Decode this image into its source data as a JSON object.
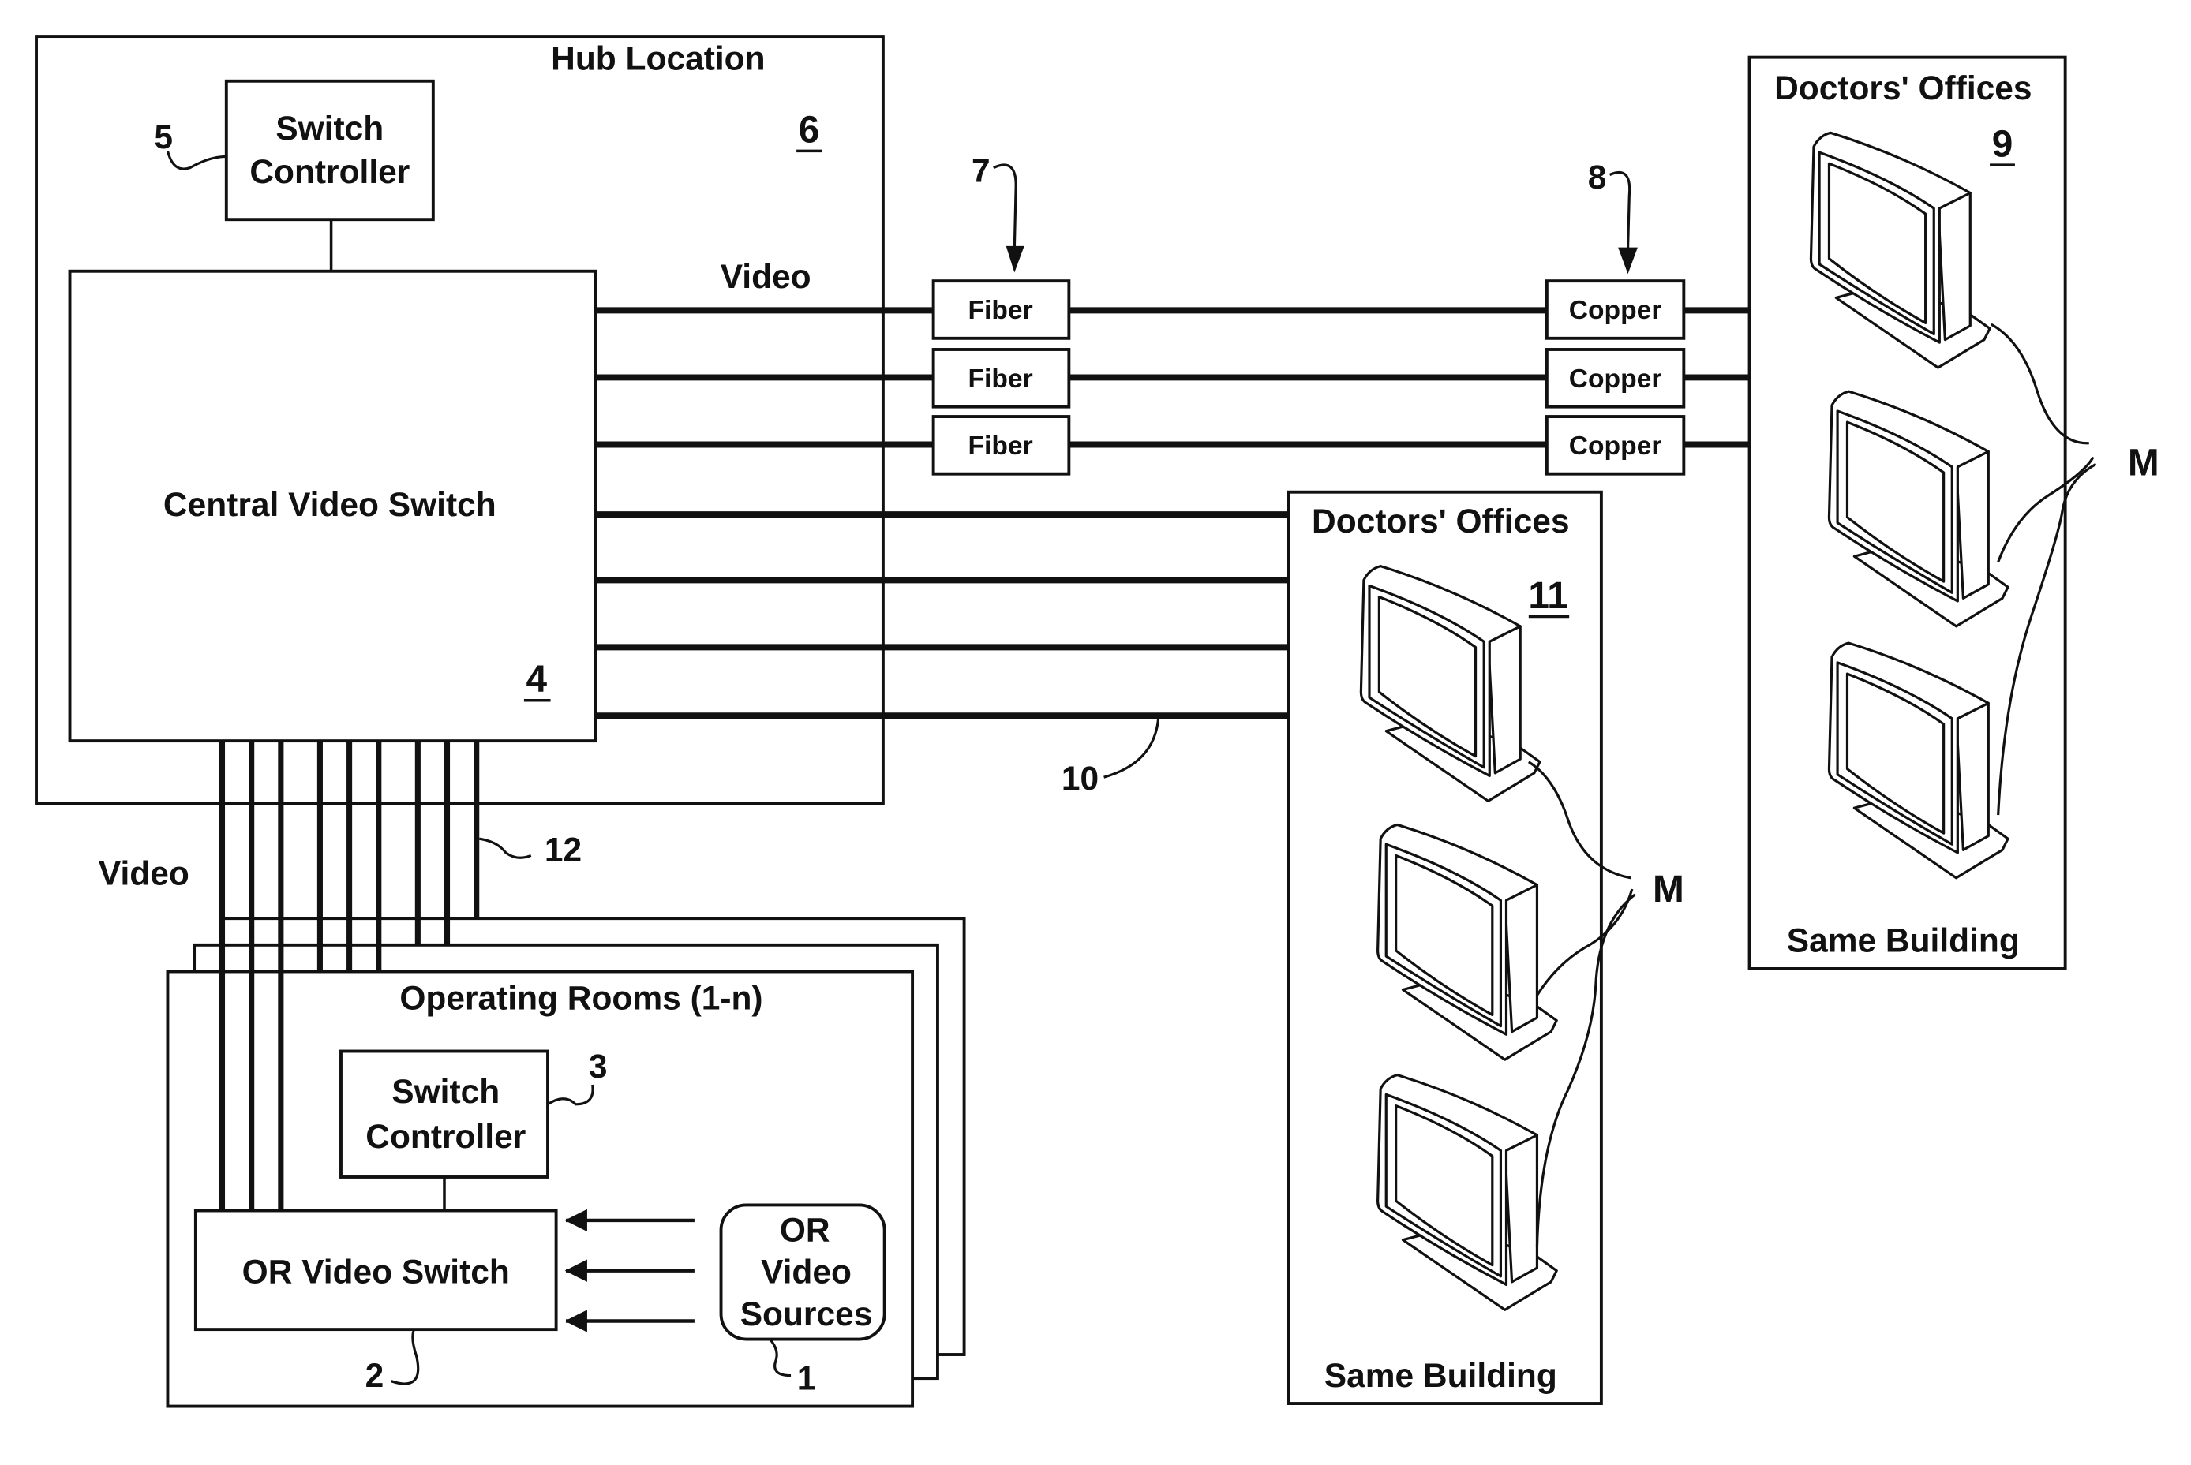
{
  "diagram": {
    "hub": {
      "title": "Hub Location",
      "ref": "6",
      "switch_controller": {
        "line1": "Switch",
        "line2": "Controller",
        "ref": "5"
      },
      "central_switch": {
        "label": "Central Video Switch",
        "ref": "4"
      },
      "video_out_label": "Video"
    },
    "fiber": {
      "ref": "7",
      "boxes": [
        "Fiber",
        "Fiber",
        "Fiber"
      ]
    },
    "copper": {
      "ref": "8",
      "boxes": [
        "Copper",
        "Copper",
        "Copper"
      ]
    },
    "direct_link_ref": "10",
    "trunk": {
      "label": "Video",
      "ref": "12"
    },
    "office_remote": {
      "title": "Doctors' Offices",
      "ref": "9",
      "footer": "Same Building",
      "monitor_label": "M",
      "monitors": 3
    },
    "office_local": {
      "title": "Doctors' Offices",
      "ref": "11",
      "footer": "Same Building",
      "monitor_label": "M",
      "monitors": 3
    },
    "operating_rooms": {
      "title": "Operating Rooms (1-n)",
      "switch_controller": {
        "line1": "Switch",
        "line2": "Controller",
        "ref": "3"
      },
      "or_switch": {
        "label": "OR Video Switch",
        "ref": "2"
      },
      "sources": {
        "line1": "OR",
        "line2": "Video",
        "line3": "Sources",
        "ref": "1"
      }
    }
  }
}
